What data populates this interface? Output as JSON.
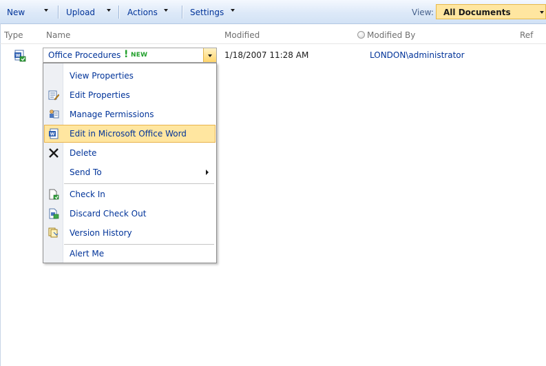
{
  "toolbar": {
    "new_label": "New",
    "upload_label": "Upload",
    "actions_label": "Actions",
    "settings_label": "Settings",
    "view_label": "View:",
    "view_value": "All Documents"
  },
  "columns": {
    "type": "Type",
    "name": "Name",
    "modified": "Modified",
    "modified_by": "Modified By",
    "ref": "Ref"
  },
  "row": {
    "name": "Office Procedures",
    "new_badge": "NEW",
    "new_mark": "!",
    "modified": "1/18/2007 11:28 AM",
    "modified_by": "LONDON\\administrator",
    "type_icon": "word-document-checked-out-icon"
  },
  "menu": {
    "items": [
      {
        "label": "View Properties",
        "icon": "none"
      },
      {
        "label": "Edit Properties",
        "icon": "edit-properties-icon"
      },
      {
        "label": "Manage Permissions",
        "icon": "manage-permissions-icon"
      },
      {
        "label": "Edit in Microsoft Office Word",
        "icon": "word-icon",
        "highlighted": true
      },
      {
        "label": "Delete",
        "icon": "delete-x-icon"
      },
      {
        "label": "Send To",
        "icon": "none",
        "submenu": true
      },
      {
        "label": "Check In",
        "icon": "check-in-icon"
      },
      {
        "label": "Discard Check Out",
        "icon": "discard-check-out-icon"
      },
      {
        "label": "Version History",
        "icon": "version-history-icon"
      },
      {
        "label": "Alert Me",
        "icon": "none"
      }
    ]
  },
  "colors": {
    "link": "#003399",
    "highlight": "#ffe6a0",
    "highlight_border": "#e8b24b",
    "new_green": "#22a02c",
    "toolbar_bg": "#d2e2f5"
  }
}
